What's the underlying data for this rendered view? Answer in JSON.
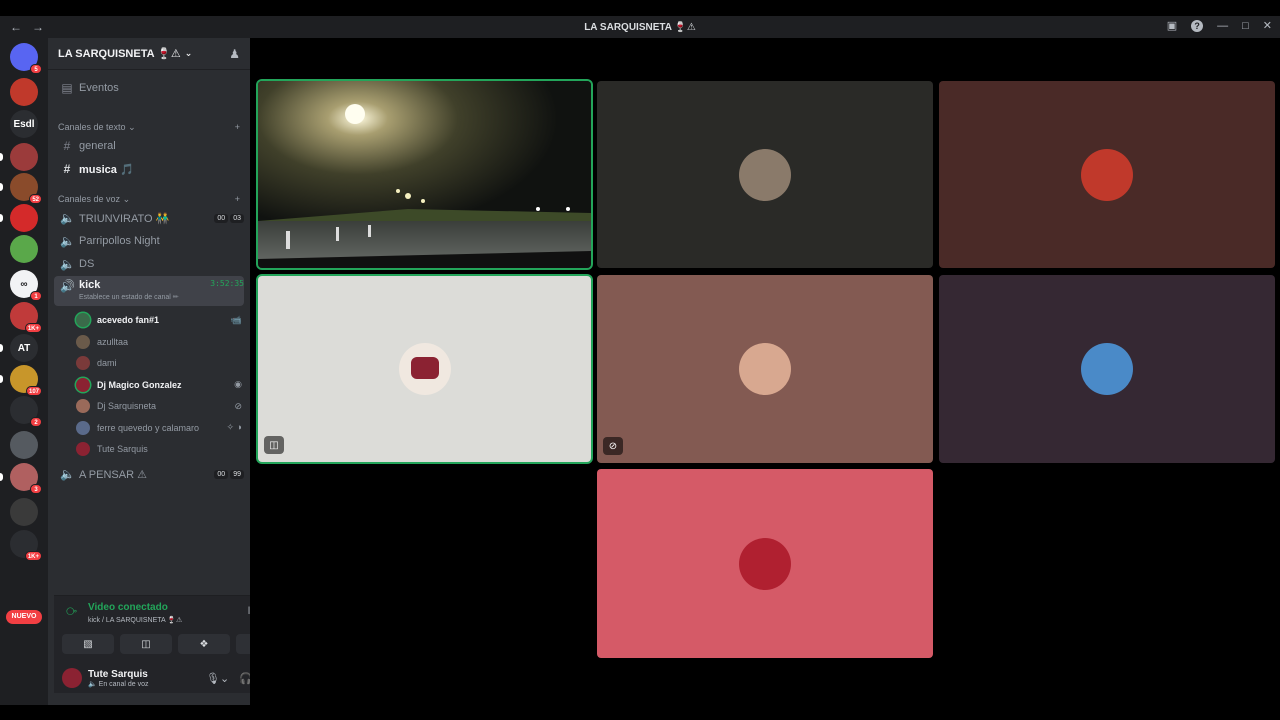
{
  "window": {
    "title": "LA SARQUISNETA 🍷⚠",
    "back_icon": "←",
    "forward_icon": "→"
  },
  "guilds": [
    {
      "name": "discord-home",
      "badge": "5",
      "color": "#5865f2",
      "text": ""
    },
    {
      "name": "guild-1",
      "badge": "",
      "color": "#c0392b",
      "text": ""
    },
    {
      "name": "guild-esdl",
      "badge": "",
      "color": "#1e1f22",
      "text": "Esdl"
    },
    {
      "name": "guild-3",
      "badge": "",
      "color": "#9b3b3b",
      "text": ""
    },
    {
      "name": "guild-4",
      "badge": "52",
      "color": "#8a4b2b",
      "text": ""
    },
    {
      "name": "guild-5",
      "badge": "",
      "color": "#d42a2a",
      "text": ""
    },
    {
      "name": "guild-6",
      "badge": "",
      "color": "#5aa84a",
      "text": ""
    },
    {
      "name": "guild-7",
      "badge": "1",
      "color": "#f2f3f5",
      "text": "∞"
    },
    {
      "name": "guild-8",
      "badge": "1K+",
      "color": "#c03a3a",
      "text": ""
    },
    {
      "name": "guild-at",
      "badge": "",
      "color": "#1e1f22",
      "text": "AT"
    },
    {
      "name": "guild-10",
      "badge": "107",
      "color": "#c8962a",
      "text": ""
    },
    {
      "name": "guild-11",
      "badge": "2",
      "color": "#1e1f22",
      "text": ""
    },
    {
      "name": "guild-12",
      "badge": "",
      "color": "#555a60",
      "text": ""
    },
    {
      "name": "guild-13",
      "badge": "3",
      "color": "#b06060",
      "text": ""
    },
    {
      "name": "guild-14",
      "badge": "",
      "color": "#3a3a3a",
      "text": ""
    },
    {
      "name": "guild-15",
      "badge": "1K+",
      "color": "#111214",
      "text": ""
    }
  ],
  "nuevo_label": "NUEVO",
  "server": {
    "name": "LA SARQUISNETA 🍷⚠",
    "events_label": "Eventos",
    "text_category": "Canales de texto",
    "voice_category": "Canales de voz",
    "text_channels": [
      {
        "name": "general"
      },
      {
        "name": "musica 🎵"
      }
    ],
    "voice_channels": [
      {
        "name": "TRIUNVIRATO 👬",
        "count_a": "00",
        "count_b": "03"
      },
      {
        "name": "Parripollos Night"
      },
      {
        "name": "DS"
      },
      {
        "name": "kick",
        "timer": "3:52:35",
        "status_prompt": "Establece un estado de canal ✏"
      },
      {
        "name": "A PENSAR ⚠",
        "count_a": "00",
        "count_b": "99"
      }
    ],
    "voice_users": [
      {
        "name": "acevedo fan#1",
        "icon": "📹",
        "color": "#3a6b4a"
      },
      {
        "name": "azulltaa",
        "icon": "",
        "color": "#6a5a4a"
      },
      {
        "name": "dami",
        "icon": "",
        "color": "#7a3a3a"
      },
      {
        "name": "Dj Magico Gonzalez",
        "icon": "◉",
        "color": "#8b2232"
      },
      {
        "name": "Dj Sarquisneta",
        "icon": "⊘",
        "color": "#9a6a5a"
      },
      {
        "name": "ferre quevedo y calamaro",
        "icon": "✧ ◑",
        "color": "#5a6a8a"
      },
      {
        "name": "Tute Sarquis",
        "icon": "",
        "color": "#8b2232"
      }
    ]
  },
  "voice_panel": {
    "status": "Video conectado",
    "location": "kick / LA SARQUISNETA 🍷⚠",
    "user_name": "Tute Sarquis",
    "user_status": "🔈 En canal de voz"
  },
  "colors": {
    "speaking": "#23a55a",
    "danger": "#f23f43",
    "sidebar_bg": "#2b2d31",
    "tile_1": "#2a2a27",
    "tile_2": "#4a2a27",
    "tile_3": "#dcdcd8",
    "tile_4": "#835a52",
    "tile_5": "#352833",
    "tile_6": "#d55a67"
  }
}
